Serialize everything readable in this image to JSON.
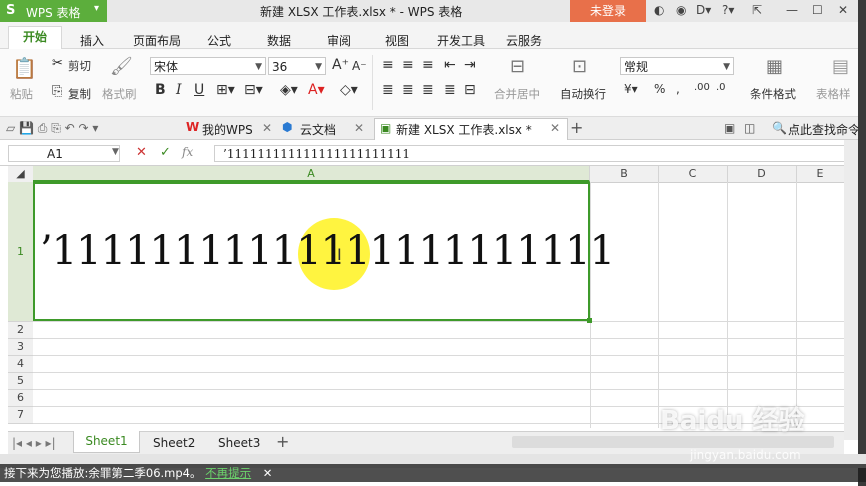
{
  "app": {
    "wps_label": "WPS 表格",
    "doc_title": "新建 XLSX 工作表.xlsx * - WPS 表格",
    "login_label": "未登录"
  },
  "ribbon_tabs": [
    "开始",
    "插入",
    "页面布局",
    "公式",
    "数据",
    "审阅",
    "视图",
    "开发工具",
    "云服务"
  ],
  "ribbon": {
    "cut": "剪切",
    "copy": "复制",
    "paste": "粘贴",
    "format_painter": "格式刷",
    "font_name": "宋体",
    "font_size": "36",
    "merge_center": "合并居中",
    "wrap_text": "自动换行",
    "number_format": "常规",
    "conditional_format": "条件格式",
    "table_style": "表格样"
  },
  "doc_tabs": {
    "my_wps": "我的WPS",
    "cloud_docs": "云文档",
    "active_file": "新建 XLSX 工作表.xlsx *",
    "find_command": "点此查找命令"
  },
  "formula_bar": {
    "cell_ref": "A1",
    "formula": "’111111111111111111111111"
  },
  "grid": {
    "columns": [
      "A",
      "B",
      "C",
      "D",
      "E"
    ],
    "rows": [
      "1",
      "2",
      "3",
      "4",
      "5",
      "6",
      "7"
    ],
    "a1_value": "’11111111111111111111111"
  },
  "sheets": [
    "Sheet1",
    "Sheet2",
    "Sheet3"
  ],
  "notice": {
    "text": "接下来为您播放:余罪第二季06.mp4。",
    "link": "不再提示"
  },
  "watermark": {
    "logo": "Baidu 经验",
    "url": "jingyan.baidu.com"
  }
}
